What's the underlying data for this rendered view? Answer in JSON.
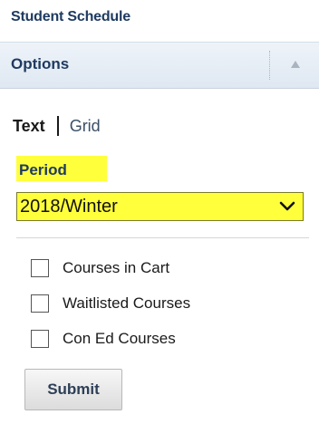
{
  "page": {
    "title": "Student Schedule"
  },
  "options_panel": {
    "title": "Options",
    "collapse_icon": "triangle-up-icon"
  },
  "view_toggle": {
    "text_label": "Text",
    "grid_label": "Grid",
    "selected": "Text"
  },
  "period": {
    "label": "Period",
    "selected_value": "2018/Winter",
    "highlight_color": "#ffff3c"
  },
  "filters": [
    {
      "label": "Courses in Cart",
      "checked": false
    },
    {
      "label": "Waitlisted Courses",
      "checked": false
    },
    {
      "label": "Con Ed Courses",
      "checked": false
    }
  ],
  "submit": {
    "label": "Submit"
  },
  "colors": {
    "heading": "#1f3a60",
    "header_bg": "#dfe8f2"
  }
}
